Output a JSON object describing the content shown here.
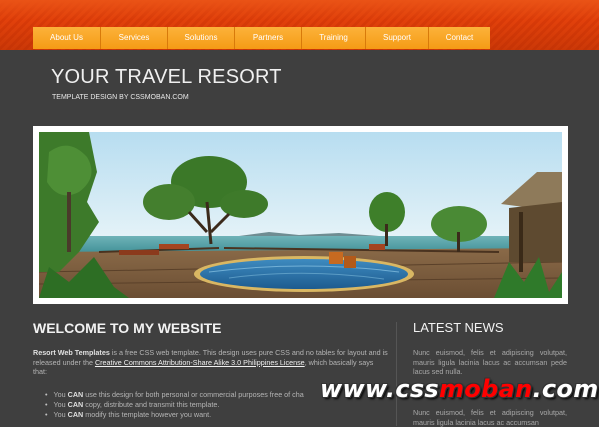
{
  "nav": {
    "items": [
      {
        "label": "About Us"
      },
      {
        "label": "Services"
      },
      {
        "label": "Solutions"
      },
      {
        "label": "Partners"
      },
      {
        "label": "Training"
      },
      {
        "label": "Support"
      },
      {
        "label": "Contact"
      }
    ]
  },
  "header": {
    "title": "YOUR TRAVEL RESORT",
    "subtitle": "TEMPLATE DESIGN BY CSSMOBAN.COM"
  },
  "main": {
    "heading": "WELCOME TO MY WEBSITE",
    "intro_strong": "Resort Web Templates",
    "intro_text_1": " is a free CSS web template. This design uses pure CSS and no tables for layout and is released under the ",
    "license_link": "Creative Commons Attribution-Share Alike 3.0 Philippines License",
    "intro_text_2": ", which basically says that:",
    "bullets": [
      {
        "pre": "You ",
        "strong": "CAN",
        "post": " use this design for both personal or commercial purposes free of cha"
      },
      {
        "pre": "You ",
        "strong": "CAN",
        "post": " copy, distribute and transmit this template."
      },
      {
        "pre": "You ",
        "strong": "CAN",
        "post": " modify this template however you want."
      }
    ]
  },
  "sidebar": {
    "heading": "LATEST NEWS",
    "news": [
      {
        "text": "Nunc euismod, felis et adipiscing volutpat, mauris ligula lacinia lacus ac accumsan pede lacus sed nulla."
      },
      {
        "text": "Nunc euismod, felis et adipiscing volutpat, mauris ligula lacinia lacus ac accumsan"
      }
    ]
  },
  "watermark": {
    "prefix": "www.css",
    "mid": "moban",
    "suffix": ".com"
  },
  "colors": {
    "topbar": "#e2410b",
    "nav": "#f8a627",
    "background": "#3f3f3f"
  }
}
